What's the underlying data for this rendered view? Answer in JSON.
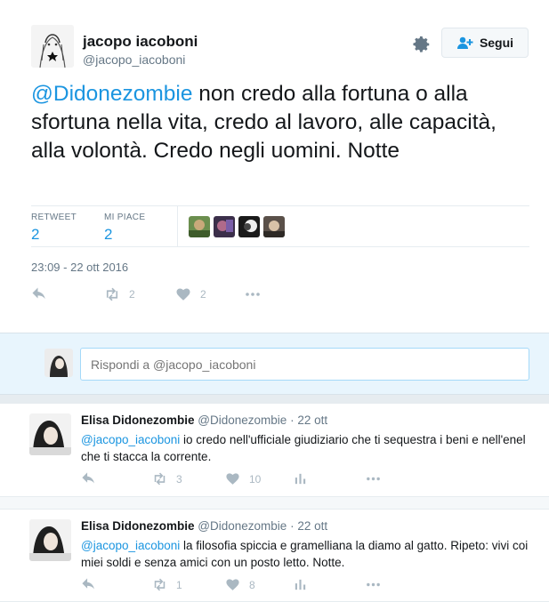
{
  "tweet": {
    "author_name": "jacopo iacoboni",
    "author_handle": "@jacopo_iacoboni",
    "follow_label": "Segui",
    "text_mention": "@Didonezombie",
    "text_body": " non credo alla fortuna o alla sfortuna nella vita, credo al lavoro, alle capacità, alla volontà. Credo negli uomini. Notte",
    "stats": {
      "retweet_label": "RETWEET",
      "retweet_count": "2",
      "likes_label": "MI PIACE",
      "likes_count": "2"
    },
    "timestamp": "23:09 - 22 ott 2016",
    "actions": {
      "retweets": "2",
      "likes": "2"
    }
  },
  "reply_box": {
    "placeholder": "Rispondi a @jacopo_iacoboni"
  },
  "replies": [
    {
      "name": "Elisa Didonezombie",
      "handle": "@Didonezombie",
      "time": "· 22 ott",
      "mention": "@jacopo_iacoboni",
      "text": " io credo nell'ufficiale giudiziario che ti sequestra i beni e nell'enel che ti stacca la corrente.",
      "retweets": "3",
      "likes": "10"
    },
    {
      "name": "Elisa Didonezombie",
      "handle": "@Didonezombie",
      "time": "· 22 ott",
      "mention": "@jacopo_iacoboni",
      "text": " la filosofia spiccia e gramelliana la diamo al gatto. Ripeto: vivi coi miei soldi e senza amici con un posto letto. Notte.",
      "retweets": "1",
      "likes": "8"
    }
  ],
  "icons": {
    "gear": "gear-icon",
    "follow": "add-user-icon",
    "reply": "reply-icon",
    "retweet": "retweet-icon",
    "like": "heart-icon",
    "more": "more-icon",
    "analytics": "analytics-icon"
  },
  "colors": {
    "link": "#1b95e0",
    "muted": "#657786",
    "icon": "#aab8c2",
    "reply_bg": "#e8f5fd"
  }
}
